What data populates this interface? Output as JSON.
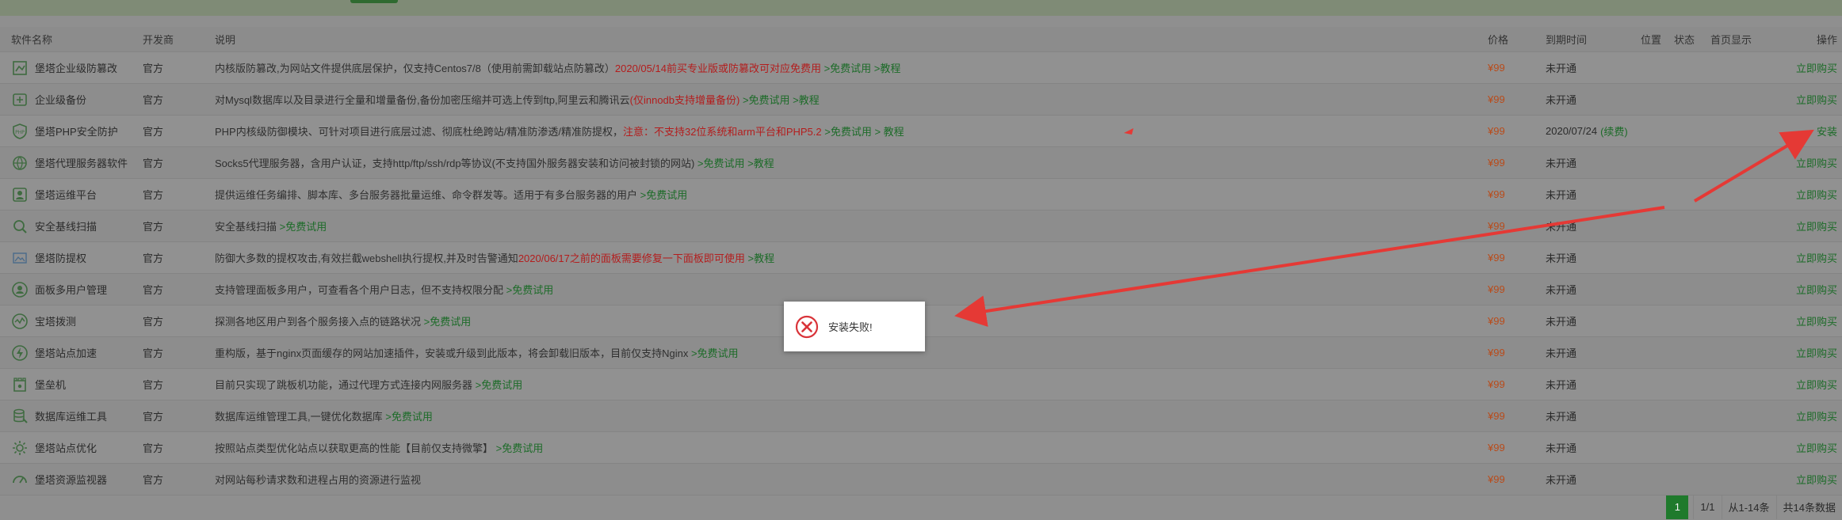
{
  "headers": {
    "name": "软件名称",
    "dev": "开发商",
    "desc": "说明",
    "price": "价格",
    "expire": "到期时间",
    "position": "位置",
    "state": "状态",
    "home": "首页显示",
    "op": "操作"
  },
  "rows": [
    {
      "icon": "tamper-proof-icon",
      "name": "堡塔企业级防篡改",
      "dev": "官方",
      "desc": [
        {
          "t": "内核版防篡改,为网站文件提供底层保护，仅支持Centos7/8（使用前需卸载站点防篡改）",
          "c": "muted"
        },
        {
          "t": "2020/05/14前买专业版或防篡改可对应免费用",
          "c": "red"
        },
        {
          "t": " >免费试用 >教程",
          "c": "green"
        }
      ],
      "price": "¥99",
      "expire": "未开通",
      "op": "立即购买"
    },
    {
      "icon": "backup-icon",
      "name": "企业级备份",
      "dev": "官方",
      "desc": [
        {
          "t": "对Mysql数据库以及目录进行全量和增量备份,备份加密压缩并可选上传到ftp,阿里云和腾讯云",
          "c": "muted"
        },
        {
          "t": "(仅innodb支持增量备份)",
          "c": "red"
        },
        {
          "t": " >免费试用 >教程",
          "c": "green"
        }
      ],
      "price": "¥99",
      "expire": "未开通",
      "op": "立即购买"
    },
    {
      "icon": "php-shield-icon",
      "name": "堡塔PHP安全防护",
      "dev": "官方",
      "desc": [
        {
          "t": "PHP内核级防御模块、可针对项目进行底层过滤、彻底杜绝跨站/精准防渗透/精准防提权，",
          "c": "muted"
        },
        {
          "t": "注意：不支持32位系统和arm平台和PHP5.2",
          "c": "red"
        },
        {
          "t": " >免费试用 > 教程",
          "c": "green"
        }
      ],
      "price": "¥99",
      "expire": "2020/07/24",
      "expire_extra": "(续费)",
      "op": "安装"
    },
    {
      "icon": "proxy-icon",
      "name": "堡塔代理服务器软件",
      "dev": "官方",
      "desc": [
        {
          "t": "Socks5代理服务器，含用户认证，支持http/ftp/ssh/rdp等协议(不支持国外服务器安装和访问被封锁的网站)",
          "c": "muted"
        },
        {
          "t": " >免费试用 >教程",
          "c": "green"
        }
      ],
      "price": "¥99",
      "expire": "未开通",
      "op": "立即购买"
    },
    {
      "icon": "ops-platform-icon",
      "name": "堡塔运维平台",
      "dev": "官方",
      "desc": [
        {
          "t": "提供运维任务编排、脚本库、多台服务器批量运维、命令群发等。适用于有多台服务器的用户",
          "c": "muted"
        },
        {
          "t": " >免费试用",
          "c": "green"
        }
      ],
      "price": "¥99",
      "expire": "未开通",
      "op": "立即购买"
    },
    {
      "icon": "baseline-scan-icon",
      "name": "安全基线扫描",
      "dev": "官方",
      "desc": [
        {
          "t": "安全基线扫描",
          "c": "muted"
        },
        {
          "t": " >免费试用",
          "c": "green"
        }
      ],
      "price": "¥99",
      "expire": "未开通",
      "op": "立即购买"
    },
    {
      "icon": "broken-image-icon",
      "name": "堡塔防提权",
      "dev": "官方",
      "desc": [
        {
          "t": "防御大多数的提权攻击,有效拦截webshell执行提权,并及时告警通知",
          "c": "muted"
        },
        {
          "t": "2020/06/17之前的面板需要修复一下面板即可使用",
          "c": "red"
        },
        {
          "t": " >教程",
          "c": "green"
        }
      ],
      "price": "¥99",
      "expire": "未开通",
      "op": "立即购买"
    },
    {
      "icon": "multi-user-icon",
      "name": "面板多用户管理",
      "dev": "官方",
      "desc": [
        {
          "t": "支持管理面板多用户，可查看各个用户日志，但不支持权限分配",
          "c": "muted"
        },
        {
          "t": " >免费试用",
          "c": "green"
        }
      ],
      "price": "¥99",
      "expire": "未开通",
      "op": "立即购买"
    },
    {
      "icon": "probe-icon",
      "name": "宝塔拨测",
      "dev": "官方",
      "desc": [
        {
          "t": "探测各地区用户到各个服务接入点的链路状况",
          "c": "muted"
        },
        {
          "t": " >免费试用",
          "c": "green"
        }
      ],
      "price": "¥99",
      "expire": "未开通",
      "op": "立即购买"
    },
    {
      "icon": "accelerate-icon",
      "name": "堡塔站点加速",
      "dev": "官方",
      "desc": [
        {
          "t": "重构版，基于nginx页面缓存的网站加速插件，安装或升级到此版本，将会卸载旧版本，目前仅支持Nginx",
          "c": "muted"
        },
        {
          "t": " >免费试用",
          "c": "green"
        }
      ],
      "price": "¥99",
      "expire": "未开通",
      "op": "立即购买"
    },
    {
      "icon": "bastion-icon",
      "name": "堡垒机",
      "dev": "官方",
      "desc": [
        {
          "t": "目前只实现了跳板机功能，通过代理方式连接内网服务器",
          "c": "muted"
        },
        {
          "t": " >免费试用",
          "c": "green"
        }
      ],
      "price": "¥99",
      "expire": "未开通",
      "op": "立即购买"
    },
    {
      "icon": "database-ops-icon",
      "name": "数据库运维工具",
      "dev": "官方",
      "desc": [
        {
          "t": "数据库运维管理工具,一键优化数据库",
          "c": "muted"
        },
        {
          "t": " >免费试用",
          "c": "green"
        }
      ],
      "price": "¥99",
      "expire": "未开通",
      "op": "立即购买"
    },
    {
      "icon": "site-optimize-icon",
      "name": "堡塔站点优化",
      "dev": "官方",
      "desc": [
        {
          "t": "按照站点类型优化站点以获取更高的性能【目前仅支持微擎】",
          "c": "muted"
        },
        {
          "t": " >免费试用",
          "c": "green"
        }
      ],
      "price": "¥99",
      "expire": "未开通",
      "op": "立即购买"
    },
    {
      "icon": "resource-monitor-icon",
      "name": "堡塔资源监视器",
      "dev": "官方",
      "desc": [
        {
          "t": "对网站每秒请求数和进程占用的资源进行监视",
          "c": "muted"
        }
      ],
      "price": "¥99",
      "expire": "未开通",
      "op": "立即购买"
    }
  ],
  "pager": {
    "current": "1",
    "pages": "1/1",
    "range": "从1-14条",
    "total": "共14条数据"
  },
  "dialog": {
    "icon": "error-icon",
    "message": "安装失败!"
  },
  "colors": {
    "accent_green": "#1f7a2c",
    "warning_red": "#b31d1d",
    "arrow_red": "#e53935"
  }
}
